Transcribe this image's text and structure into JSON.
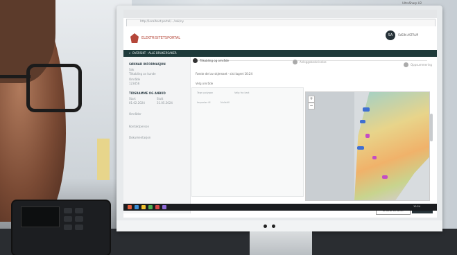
{
  "monitor": {
    "brand_label": "UltraSharp U2"
  },
  "browser": {
    "url": "http://localhost:portal/.../sak/ny"
  },
  "app": {
    "brand": "ELEKTRISITETSPORTAL",
    "user_initials": "SA",
    "user_name": "SVEIN ASTRUP",
    "nav_back_label": "← OVERSIKT · ALLE BRUKERSAKER"
  },
  "sidebar": {
    "section1_title": "SØKNAD INFORMASJON",
    "section1_lines": [
      "Sak",
      "Tilkobling av kunde",
      "Område",
      "123456"
    ],
    "section2_title": "TIDSRAMME OG ANBUD",
    "section2_lines": [
      "Start",
      "01.02.2024",
      "Slutt",
      "31.05.2024"
    ],
    "extra1": "Områder",
    "extra2": "Kontaktperson",
    "extra3": "Dokumentasjon"
  },
  "steps": [
    {
      "label": "Tilkobling og område",
      "active": true
    },
    {
      "label": "Anleggsbeskrivelse",
      "active": false
    },
    {
      "label": "Oppsummering",
      "active": false
    }
  ],
  "main": {
    "meta_line": "Første del av skjemaet · sist lagret 10:24",
    "section_label": "Velg område",
    "chips": [
      "Tegn polygon",
      "Velg fra kart",
      "Importer fil",
      "Nullstill"
    ]
  },
  "map": {
    "zoom_in": "+",
    "zoom_out": "−"
  },
  "buttons": {
    "secondary": "LAGRE UTKAST",
    "primary": "NESTE"
  },
  "taskbar": {
    "clock": "10:24"
  },
  "colors": {
    "accent": "#b5473a",
    "nav": "#1e3a3a",
    "primary_button": "#263238"
  }
}
